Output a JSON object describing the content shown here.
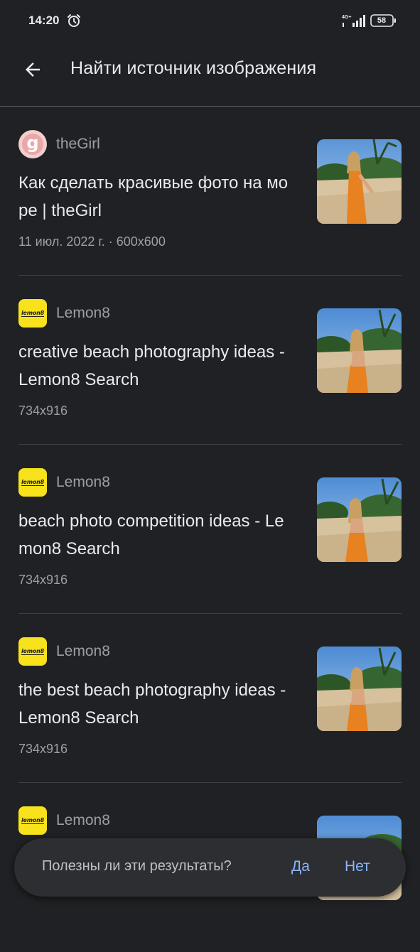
{
  "status_bar": {
    "time": "14:20",
    "network": "4G+",
    "battery": "58"
  },
  "header": {
    "title": "Найти источник изображения"
  },
  "results": [
    {
      "source": "theGirl",
      "logo": "thegirl-logo",
      "title": "Как сделать красивые фото на море | theGirl",
      "meta": "11 июл. 2022 г. · 600x600"
    },
    {
      "source": "Lemon8",
      "logo": "lemon8-logo",
      "title": "creative beach photography ideas - Lemon8 Search",
      "meta": "734x916"
    },
    {
      "source": "Lemon8",
      "logo": "lemon8-logo",
      "title": "beach photo competition ideas - Lemon8 Search",
      "meta": "734x916"
    },
    {
      "source": "Lemon8",
      "logo": "lemon8-logo",
      "title": "the best beach photography ideas - Lemon8 Search",
      "meta": "734x916"
    },
    {
      "source": "Lemon8",
      "logo": "lemon8-logo",
      "title": "",
      "meta": ""
    }
  ],
  "logos": {
    "thegirl_letter": "g",
    "lemon8_text": "lemon8"
  },
  "feedback": {
    "question": "Полезны ли эти результаты?",
    "yes": "Да",
    "no": "Нет"
  },
  "colors": {
    "background": "#202124",
    "accent": "#8ab4f8",
    "lemon8_yellow": "#f7e21b"
  }
}
